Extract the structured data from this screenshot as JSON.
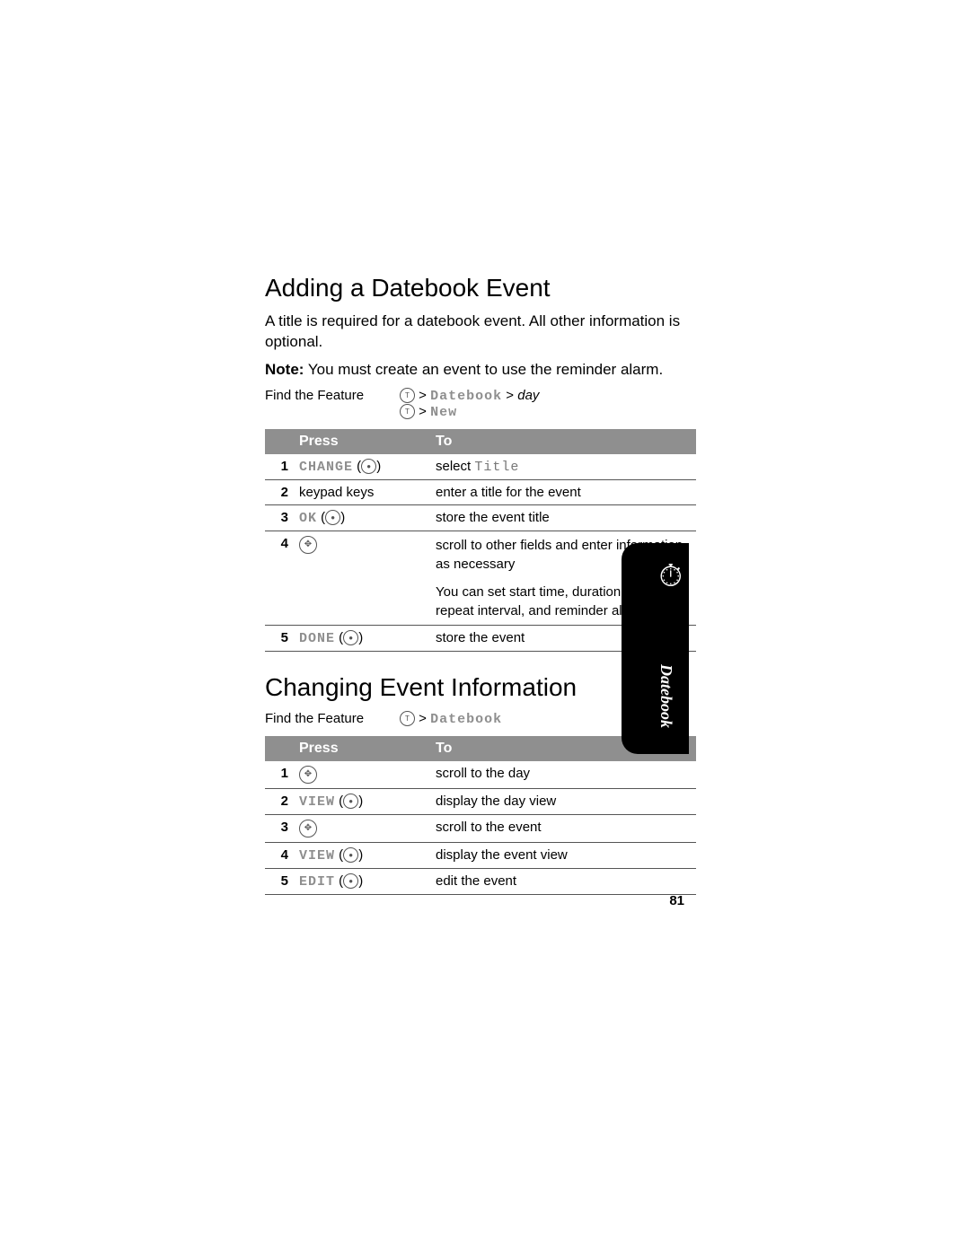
{
  "page_number": "81",
  "tab_label": "Datebook",
  "section1": {
    "heading": "Adding a Datebook Event",
    "intro": "A title is required for a datebook event. All other information is optional.",
    "note_label": "Note:",
    "note_text": " You must create an event to use the reminder alarm.",
    "find_feature_label": "Find the Feature",
    "path_line1_pre": " > ",
    "path_line1_mono": "Datebook",
    "path_line1_sep": " > ",
    "path_line1_day": "day",
    "path_line2_pre": " > ",
    "path_line2_mono": "New",
    "table": {
      "col1": "Press",
      "col2": "To",
      "rows": [
        {
          "n": "1",
          "press": "CHANGE",
          "key": "dot",
          "to_pre": "select ",
          "to_mono": "Title"
        },
        {
          "n": "2",
          "press_plain": "keypad keys",
          "to": "enter a title for the event"
        },
        {
          "n": "3",
          "press": "OK",
          "key": "dot",
          "to": "store the event title"
        },
        {
          "n": "4",
          "press_icon": "nav",
          "to": "scroll to other fields and enter information as necessary"
        },
        {
          "n": "",
          "extra": "You can set start time, duration, date, repeat interval, and reminder alarm."
        },
        {
          "n": "5",
          "press": "DONE",
          "key": "dot",
          "to": "store the event"
        }
      ]
    }
  },
  "section2": {
    "heading": "Changing Event Information",
    "find_feature_label": "Find the Feature",
    "path_pre": " > ",
    "path_mono": "Datebook",
    "table": {
      "col1": "Press",
      "col2": "To",
      "rows": [
        {
          "n": "1",
          "press_icon": "nav",
          "to": "scroll to the day"
        },
        {
          "n": "2",
          "press": "VIEW",
          "key": "dot",
          "to": "display the day view"
        },
        {
          "n": "3",
          "press_icon": "nav",
          "to": "scroll to the event"
        },
        {
          "n": "4",
          "press": "VIEW",
          "key": "dot",
          "to": "display the event view"
        },
        {
          "n": "5",
          "press": "EDIT",
          "key": "dot",
          "to": "edit the event"
        }
      ]
    }
  }
}
